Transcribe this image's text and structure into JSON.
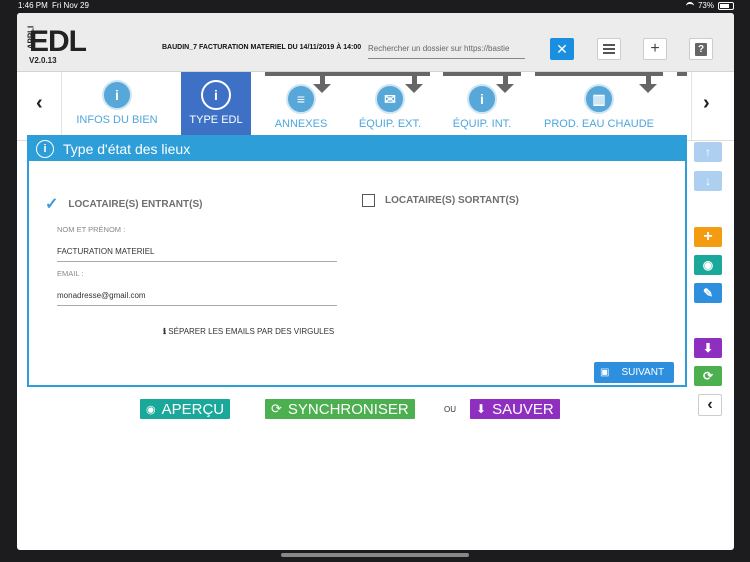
{
  "status": {
    "time": "1:46 PM",
    "date": "Fri Nov 29",
    "battery": "73%"
  },
  "header": {
    "logo_small": "APPLI",
    "logo_main": "EDL",
    "version": "V2.0.13",
    "doc_title": "BAUDIN_7 FACTURATION MATERIEL DU 14/11/2019 À 14:00",
    "search_placeholder": "Rechercher un dossier sur https://bastie",
    "help_symbol": "?"
  },
  "tabs": [
    {
      "label": "INFOS DU BIEN",
      "icon": "info-icon",
      "active": false
    },
    {
      "label": "TYPE EDL",
      "icon": "info-icon",
      "active": true
    },
    {
      "label": "ANNEXES",
      "icon": "document-icon",
      "active": false
    },
    {
      "label": "ÉQUIP. EXT.",
      "icon": "mailbox-icon",
      "active": false
    },
    {
      "label": "ÉQUIP. INT.",
      "icon": "info-icon",
      "active": false
    },
    {
      "label": "PROD. EAU CHAUDE",
      "icon": "water-heater-icon",
      "active": false
    }
  ],
  "panel": {
    "title": "Type d'état des lieux",
    "option_in": "LOCATAIRE(S) ENTRANT(S)",
    "option_out": "LOCATAIRE(S) SORTANT(S)",
    "name_label": "NOM ET PRÉNOM :",
    "name_value": "FACTURATION MATERIEL",
    "email_label": "EMAIL :",
    "email_value": "monadresse@gmail.com",
    "hint": "SÉPARER LES EMAILS PAR DES VIRGULES",
    "next_label": "SUIVANT"
  },
  "bottom": {
    "preview_label": "APERÇU",
    "sync_label": "SYNCHRONISER",
    "or_label": "OU",
    "save_label": "SAUVER"
  },
  "colors": {
    "primary": "#2e9ed9",
    "active_tab": "#3e71c6",
    "orange": "#f39c12",
    "teal": "#1aa89a",
    "green": "#4caf50",
    "purple": "#8e2fc0"
  }
}
